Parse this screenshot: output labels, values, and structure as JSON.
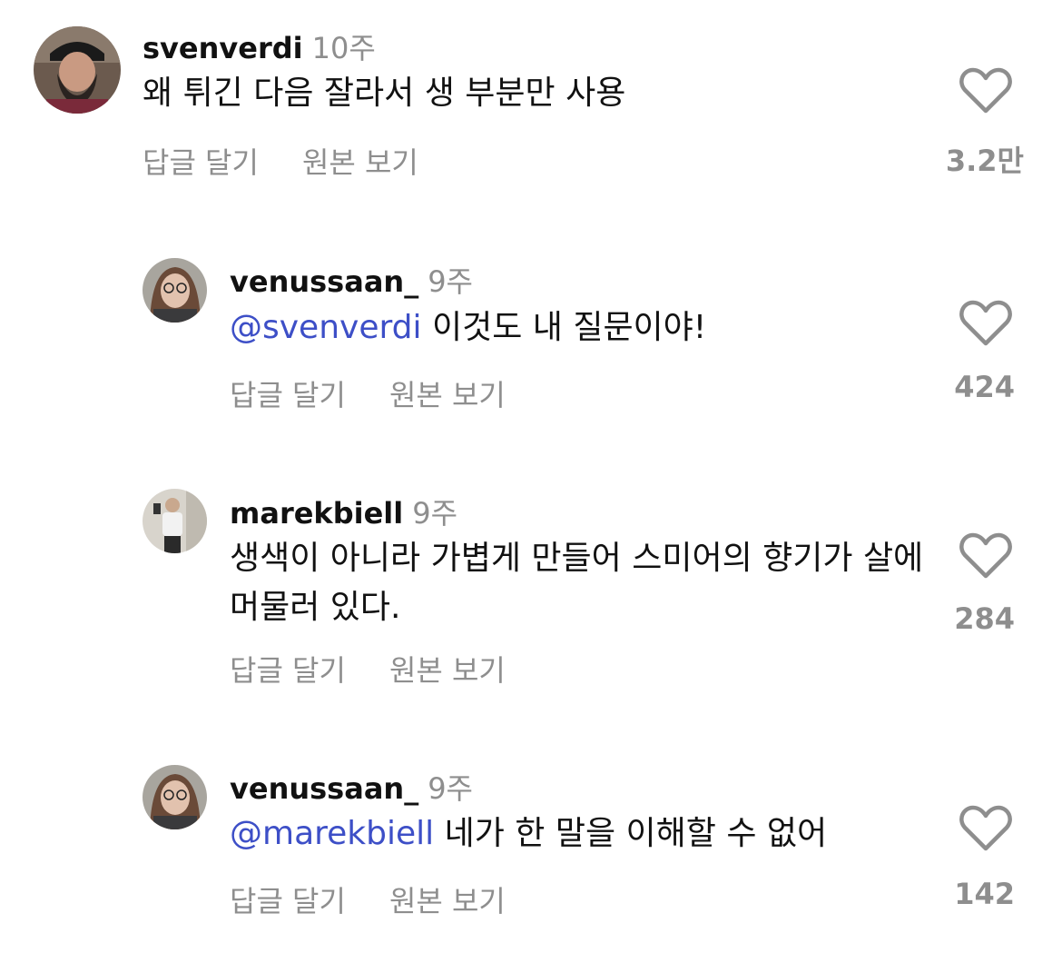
{
  "comments": [
    {
      "username": "svenverdi",
      "time": "10주",
      "mention": "",
      "text": "왜 튀긴 다음 잘라서 생 부분만 사용",
      "reply_label": "답글 달기",
      "view_original_label": "원본 보기",
      "like_count": "3.2만",
      "avatar_icon": "bearded-man-avatar"
    },
    {
      "username": "venussaan_",
      "time": "9주",
      "mention": "@svenverdi",
      "text": "이것도 내 질문이야!",
      "reply_label": "답글 달기",
      "view_original_label": "원본 보기",
      "like_count": "424",
      "avatar_icon": "woman-glasses-avatar"
    },
    {
      "username": "marekbiell",
      "time": "9주",
      "mention": "",
      "text": "생색이 아니라 가볍게 만들어 스미어의 향기가 살에 머물러 있다.",
      "reply_label": "답글 달기",
      "view_original_label": "원본 보기",
      "like_count": "284",
      "avatar_icon": "mirror-selfie-avatar"
    },
    {
      "username": "venussaan_",
      "time": "9주",
      "mention": "@marekbiell",
      "text": "네가 한 말을 이해할 수 없어",
      "reply_label": "답글 달기",
      "view_original_label": "원본 보기",
      "like_count": "142",
      "avatar_icon": "woman-glasses-avatar"
    }
  ],
  "colors": {
    "mention": "#3d4fc7",
    "secondary_text": "#8e8e8e",
    "primary_text": "#111111"
  }
}
